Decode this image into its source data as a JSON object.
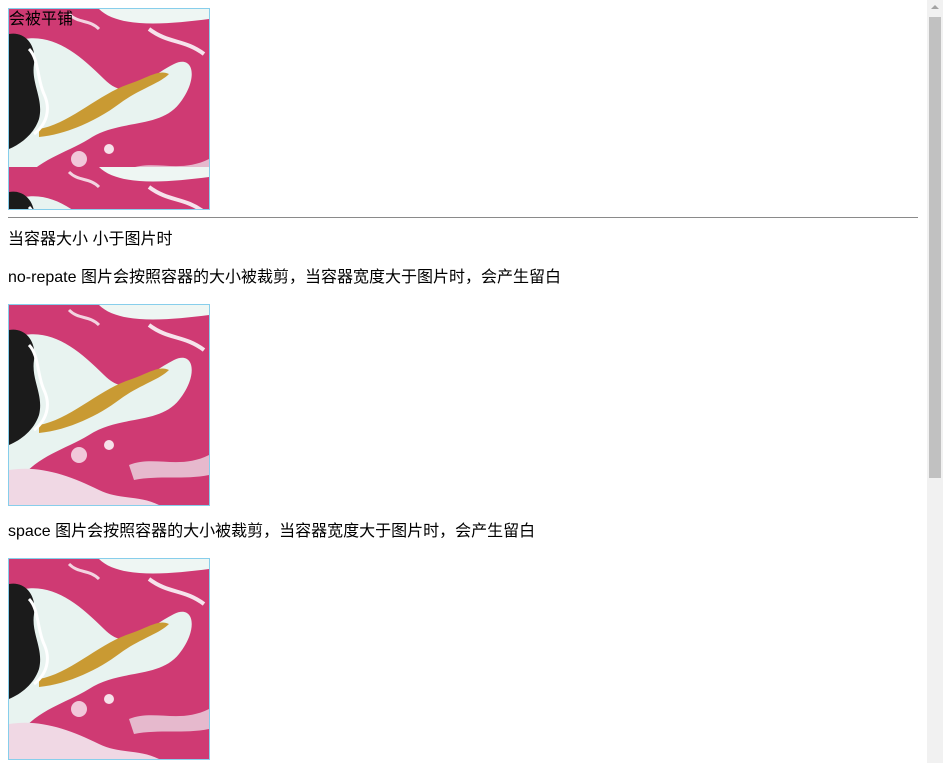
{
  "sections": {
    "tiled_label": "会被平铺",
    "small_container_heading": "当容器大小 小于图片时",
    "no_repeat_text": "no-repate 图片会按照容器的大小被裁剪，当容器宽度大于图片时，会产生留白",
    "space_text": "space 图片会按照容器的大小被裁剪，当容器宽度大于图片时，会产生留白"
  },
  "colors": {
    "box_border": "#87ceeb",
    "marble_pink": "#cf3a73",
    "marble_white": "#e8f3f0",
    "marble_gold": "#c99a33",
    "marble_black": "#1b1b1b"
  },
  "images": {
    "texture": "pink-marble-texture"
  }
}
